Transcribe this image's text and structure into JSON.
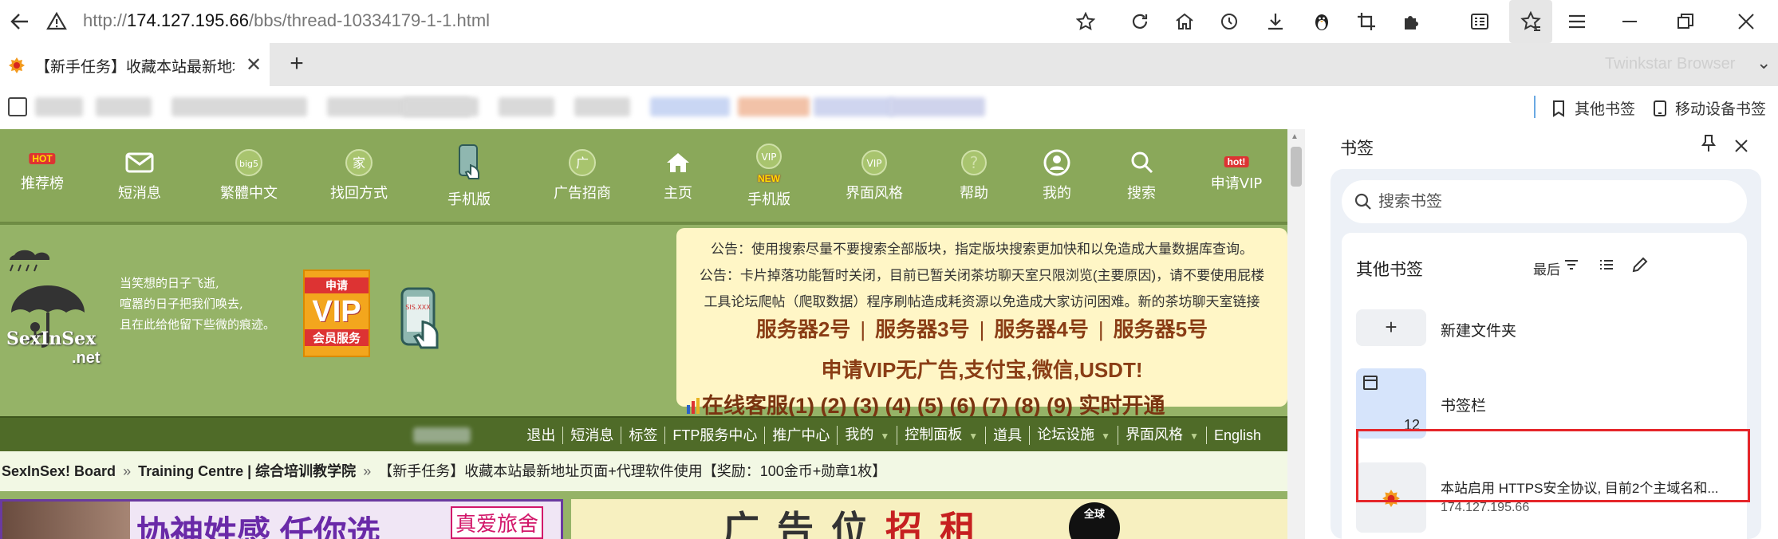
{
  "browser": {
    "url_scheme": "http://",
    "url_host": "174.127.195.66",
    "url_path": "/bbs/thread-10334179-1-1.html",
    "brand": "Twinkstar Browser",
    "tab_title": "【新手任务】收藏本站最新地址",
    "new_tab": "+",
    "bookmarks_bar_right": [
      "其他书签",
      "移动设备书签"
    ]
  },
  "site": {
    "nav": [
      {
        "label": "推荐榜",
        "badge": "HOT"
      },
      {
        "label": "短消息"
      },
      {
        "label": "繁體中文"
      },
      {
        "label": "找回方式"
      },
      {
        "label": "手机版"
      },
      {
        "label": "广告招商"
      },
      {
        "label": "主页"
      },
      {
        "label": "手机版",
        "badge": "NEW"
      },
      {
        "label": "界面风格"
      },
      {
        "label": "帮助"
      },
      {
        "label": "我的"
      },
      {
        "label": "搜索"
      },
      {
        "label": "申请VIP",
        "badge": "hot!"
      }
    ],
    "logo_text": "SexInSex",
    "logo_text2": ".net",
    "poem": [
      "当笑想的日子飞逝,",
      "喧嚣的日子把我们唤去,",
      "且在此给他留下些微的痕迹。"
    ],
    "vip_box": {
      "top": "申请",
      "mid": "VIP",
      "bottom": "会员服务"
    },
    "notice": {
      "line1": "公告：使用搜索尽量不要搜索全部版块，指定版块搜索更加快和以免造成大量数据库查询。",
      "line2": "公告：卡片掉落功能暂时关闭，目前已暂关闭茶坊聊天室只限浏览(主要原因)，请不要使用屁楼",
      "line3": "工具论坛爬帖（爬取数据）程序刷帖造成耗资源以免造成大家访问困难。新的茶坊聊天室链接",
      "servers": [
        "服务器2号",
        "服务器3号",
        "服务器4号",
        "服务器5号"
      ],
      "vip_line": "申请VIP无广告,支付宝,微信,USDT!",
      "kefu": "在线客服(1) (2) (3) (4) (5) (6) (7) (8) (9) 实时开通"
    },
    "menu": [
      {
        "label": "退出"
      },
      {
        "label": "短消息"
      },
      {
        "label": "标签"
      },
      {
        "label": "FTP服务中心"
      },
      {
        "label": "推广中心"
      },
      {
        "label": "我的",
        "caret": true
      },
      {
        "label": "控制面板",
        "caret": true
      },
      {
        "label": "道具"
      },
      {
        "label": "论坛设施",
        "caret": true
      },
      {
        "label": "界面风格",
        "caret": true
      },
      {
        "label": "English"
      }
    ],
    "breadcrumb": {
      "home": "SexInSex! Board",
      "forum": "Training Centre | 综合培训教学院",
      "thread": "【新手任务】收藏本站最新地址页面+代理软件使用【奖励：100金币+勋章1枚】",
      "sep": "»"
    },
    "ads": {
      "left_title": "协神姓感 任你选",
      "left_badge": "真爱旅舍",
      "right_title_a": "广告位",
      "right_title_b": "招",
      "right_title_c": "租",
      "circle": "全球"
    }
  },
  "bookmark_panel": {
    "title": "书签",
    "search_placeholder": "搜索书签",
    "folder_title": "其他书签",
    "sort_label": "最后",
    "new_folder": "新建文件夹",
    "bookmarks_bar_label": "书签栏",
    "bookmarks_bar_count": "12",
    "item_title": "本站启用 HTTPS安全协议, 目前2个主域名和...",
    "item_url": "174.127.195.66"
  },
  "colors": {
    "site_nav_bg": "#8aa85a",
    "site_menu_bg": "#4f6b28",
    "notice_bg": "#fff6c6",
    "server_text": "#8a3d15",
    "highlight": "#e5262a",
    "panel_bg": "#edf1f7"
  }
}
